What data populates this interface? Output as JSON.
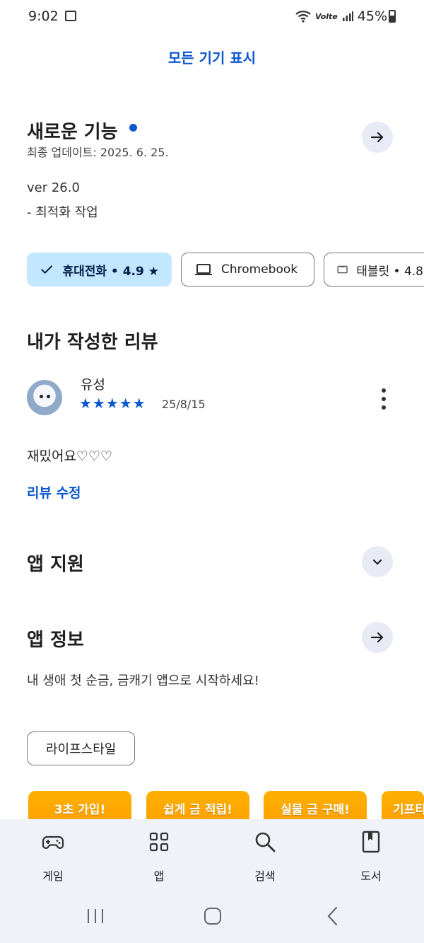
{
  "status_bar": {
    "time": "9:02",
    "network": "Volte",
    "battery": "45%"
  },
  "show_all_devices": "모든 기기 표시",
  "whats_new": {
    "title": "새로운 기능",
    "updated": "최종 업데이트: 2025. 6. 25.",
    "version": "ver 26.0",
    "note": "- 최적화 작업"
  },
  "device_chips": [
    {
      "label": "휴대전화 • 4.9 ★",
      "icon": "check-icon",
      "selected": true
    },
    {
      "label": "Chromebook",
      "icon": "laptop-icon",
      "selected": false
    },
    {
      "label": "태블릿 • 4.8",
      "icon": "tablet-icon",
      "selected": false
    }
  ],
  "my_review": {
    "title": "내가 작성한 리뷰",
    "reviewer": "유성",
    "rating": 5,
    "stars": "★★★★★",
    "date": "25/8/15",
    "text": "재밌어요♡♡♡",
    "edit_label": "리뷰 수정"
  },
  "app_support": {
    "title": "앱 지원"
  },
  "app_info": {
    "title": "앱 정보",
    "description": "내 생애 첫 순금, 금캐기 앱으로 시작하세요!",
    "category": "라이프스타일"
  },
  "promo_cards": [
    "3초 가입!",
    "쉽게 금 적립!",
    "실물 금 구매!",
    "기프티"
  ],
  "bottom_nav": [
    {
      "label": "게임",
      "icon": "gamepad-icon"
    },
    {
      "label": "앱",
      "icon": "apps-grid-icon"
    },
    {
      "label": "검색",
      "icon": "search-icon"
    },
    {
      "label": "도서",
      "icon": "book-icon"
    }
  ],
  "colors": {
    "accent": "#0b57d0",
    "chip_selected": "#c2e7ff",
    "nav_bg": "#f0f2fa",
    "promo": "#ffa800"
  }
}
